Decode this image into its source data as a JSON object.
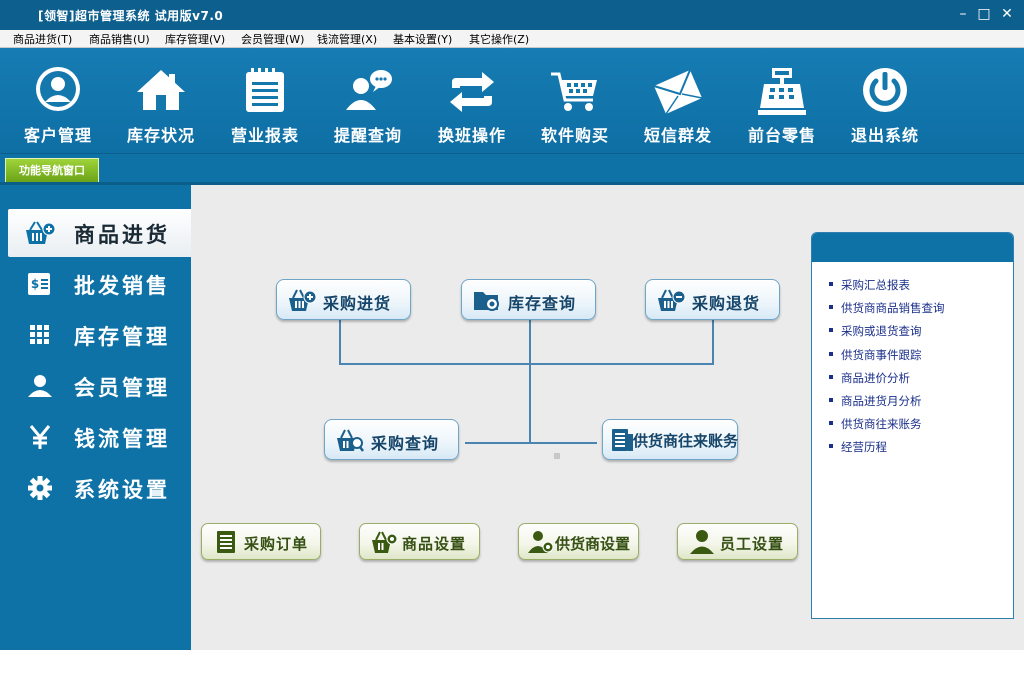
{
  "window": {
    "title": "[领智]超市管理系统 试用版v7.0"
  },
  "menu": [
    "商品进货(T)",
    "商品销售(U)",
    "库存管理(V)",
    "会员管理(W)",
    "钱流管理(X)",
    "基本设置(Y)",
    "其它操作(Z)"
  ],
  "toolbar": [
    {
      "label": "客户管理",
      "icon": "user-circle-icon"
    },
    {
      "label": "库存状况",
      "icon": "house-icon"
    },
    {
      "label": "营业报表",
      "icon": "notepad-icon"
    },
    {
      "label": "提醒查询",
      "icon": "user-chat-icon"
    },
    {
      "label": "换班操作",
      "icon": "swap-arrows-icon"
    },
    {
      "label": "软件购买",
      "icon": "shopping-cart-icon"
    },
    {
      "label": "短信群发",
      "icon": "envelope-icon"
    },
    {
      "label": "前台零售",
      "icon": "cash-register-icon"
    },
    {
      "label": "退出系统",
      "icon": "power-icon"
    }
  ],
  "nav_tab": "功能导航窗口",
  "sidebar": [
    {
      "label": "商品进货",
      "icon": "basket-plus-icon",
      "active": true
    },
    {
      "label": "批发销售",
      "icon": "receipt-dollar-icon",
      "active": false
    },
    {
      "label": "库存管理",
      "icon": "grid-icon",
      "active": false
    },
    {
      "label": "会员管理",
      "icon": "person-icon",
      "active": false
    },
    {
      "label": "钱流管理",
      "icon": "yen-icon",
      "active": false
    },
    {
      "label": "系统设置",
      "icon": "gear-icon",
      "active": false
    }
  ],
  "flow": {
    "purchase_in": "采购进货",
    "stock_query": "库存查询",
    "purchase_return": "采购退货",
    "purchase_query": "采购查询",
    "supplier_account": "供货商往来账务"
  },
  "bottom_buttons": [
    {
      "label": "采购订单",
      "icon": "list-doc-icon"
    },
    {
      "label": "商品设置",
      "icon": "basket-gear-icon"
    },
    {
      "label": "供货商设置",
      "icon": "person-gear-icon"
    },
    {
      "label": "员工设置",
      "icon": "employee-icon"
    }
  ],
  "reports": [
    "采购汇总报表",
    "供货商商品销售查询",
    "采购或退货查询",
    "供货商事件跟踪",
    "商品进价分析",
    "商品进货月分析",
    "供货商往来账务",
    "经营历程"
  ],
  "colors": {
    "primary": "#0f72a6",
    "nav_tab": "#7fbf22",
    "main_bg": "#ebebeb",
    "link": "#1a2f8a"
  }
}
